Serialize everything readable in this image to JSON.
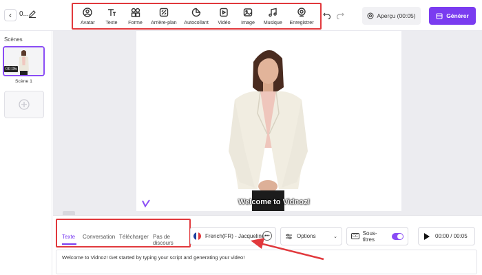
{
  "header": {
    "back_icon": "chevron-left-icon",
    "project_name": "0...",
    "edit_icon": "pencil-icon",
    "tools": [
      {
        "label": "Avatar",
        "icon": "avatar-icon"
      },
      {
        "label": "Texte",
        "icon": "text-icon"
      },
      {
        "label": "Forme",
        "icon": "shape-icon"
      },
      {
        "label": "Arrière-plan",
        "icon": "background-icon"
      },
      {
        "label": "Autocollant",
        "icon": "sticker-icon"
      },
      {
        "label": "Vidéo",
        "icon": "video-icon"
      },
      {
        "label": "Image",
        "icon": "image-icon"
      },
      {
        "label": "Musique",
        "icon": "music-icon"
      },
      {
        "label": "Enregistrer",
        "icon": "record-icon"
      }
    ],
    "preview_label": "Aperçu (00:05)",
    "generate_label": "Générer",
    "accent_color": "#7a3cf0",
    "highlight_color": "#e1383c"
  },
  "sidebar": {
    "title": "Scènes",
    "scenes": [
      {
        "label": "Scène 1",
        "duration": "00:05"
      }
    ]
  },
  "canvas": {
    "subtitle": "Welcome to Vidnoz!"
  },
  "editor": {
    "tabs": [
      {
        "label": "Texte",
        "active": true
      },
      {
        "label": "Conversation",
        "active": false
      },
      {
        "label": "Télécharger",
        "active": false
      },
      {
        "label": "Pas de discours",
        "active": false
      }
    ],
    "voice": "French(FR) - Jacqueline",
    "options_label": "Options",
    "subtitles_label": "Sous-titres",
    "subtitles_on": true,
    "time": "00:00 / 00:05",
    "script": "Welcome to Vidnoz! Get started by typing your script and generating your video!"
  }
}
